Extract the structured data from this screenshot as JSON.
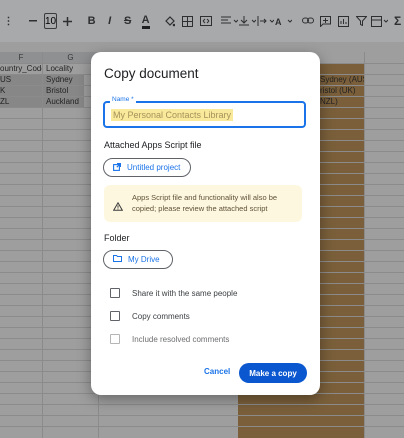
{
  "toolbar": {
    "font_size": "10",
    "items": [
      "minus",
      "plus",
      "B",
      "I",
      "S",
      "A"
    ]
  },
  "sheet": {
    "col_headers": [
      "F",
      "G"
    ],
    "header_row": [
      "ountry_Code",
      "Locality"
    ],
    "rows": [
      [
        "US",
        "Sydney"
      ],
      [
        "K",
        "Bristol"
      ],
      [
        "ZL",
        "Auckland"
      ]
    ],
    "right_values": [
      "Sydney (AUS)",
      "ristol (UK)",
      "NZL)"
    ]
  },
  "dialog": {
    "title": "Copy document",
    "name_label": "Name *",
    "name_value": "My Personal Contacts Library",
    "attached_label": "Attached Apps Script file",
    "script_button": "Untitled project",
    "warning": "Apps Script file and functionality will also be copied; please review the attached script",
    "folder_label": "Folder",
    "folder_button": "My Drive",
    "options": [
      {
        "label": "Share it with the same people",
        "checked": false,
        "disabled": false
      },
      {
        "label": "Copy comments",
        "checked": false,
        "disabled": false
      },
      {
        "label": "Include resolved comments",
        "checked": false,
        "disabled": true
      }
    ],
    "cancel": "Cancel",
    "confirm": "Make a copy"
  },
  "colors": {
    "accent": "#1a73e8",
    "primary_button": "#0b57d0",
    "warning_bg": "#fef7e0",
    "name_highlight": "#f8ea9a"
  }
}
